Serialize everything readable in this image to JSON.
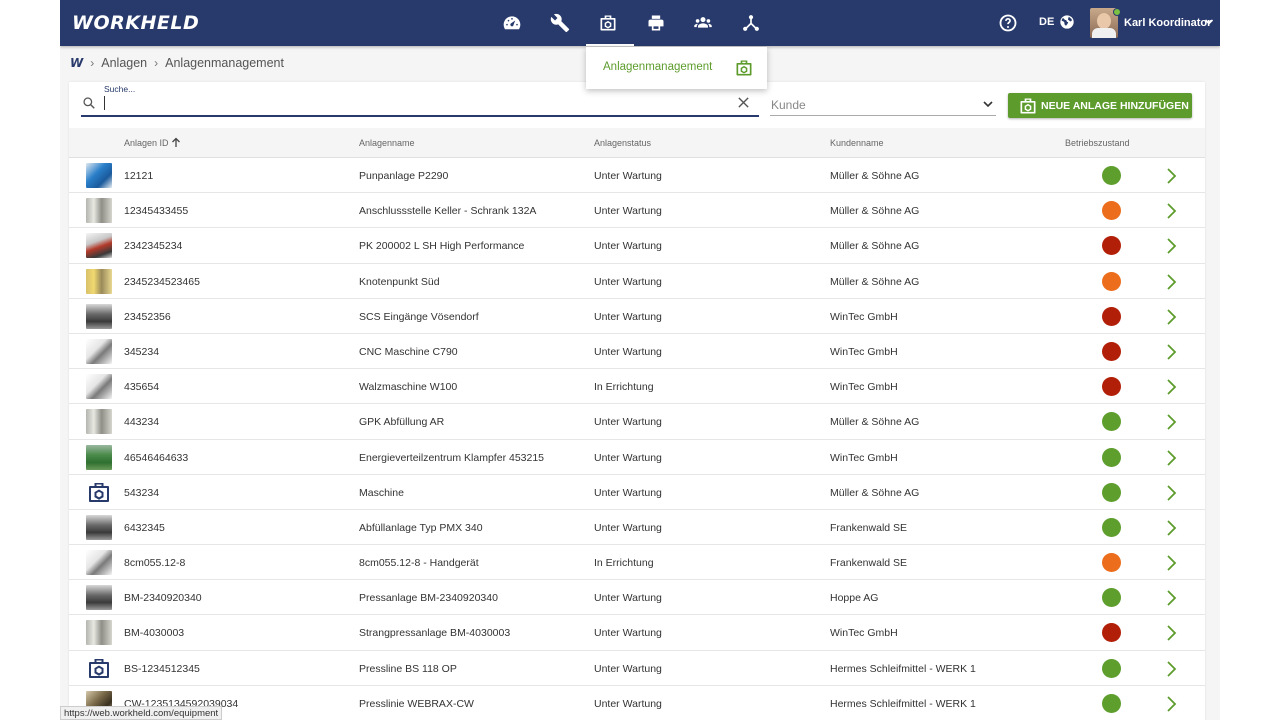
{
  "header": {
    "logo": "WORKHELD",
    "nav_icons": [
      "dashboard-icon",
      "wrench-icon",
      "equipment-icon",
      "printer-icon",
      "team-icon",
      "network-icon"
    ],
    "active_nav": "equipment-icon",
    "language": "DE",
    "user_name": "Karl Koordinator",
    "color": "#283a6c"
  },
  "breadcrumb": {
    "logo": "W",
    "items": [
      "Anlagen",
      "Anlagenmanagement"
    ]
  },
  "dropdown": {
    "label": "Anlagenmanagement"
  },
  "search": {
    "label": "Suche...",
    "value": ""
  },
  "filter": {
    "kunde_placeholder": "Kunde"
  },
  "add_button": {
    "label": "NEUE ANLAGE HINZUFÜGEN",
    "color": "#5d9c2c"
  },
  "table": {
    "headers": {
      "id": "Anlagen ID",
      "name": "Anlagenname",
      "status": "Anlagenstatus",
      "kunde": "Kundenname",
      "zustand": "Betriebszustand"
    },
    "state_colors": {
      "green": "#5e9e2d",
      "orange": "#ec6d1b",
      "red": "#b21f08"
    },
    "rows": [
      {
        "id": "12121",
        "name": "Punpanlage P2290",
        "status": "Unter Wartung",
        "kunde": "Müller & Söhne AG",
        "state": "green",
        "thumb": "photo-blue"
      },
      {
        "id": "12345433455",
        "name": "Anschlussstelle Keller - Schrank 132A",
        "status": "Unter Wartung",
        "kunde": "Müller & Söhne AG",
        "state": "orange",
        "thumb": "photo-grey"
      },
      {
        "id": "2342345234",
        "name": "PK 200002 L SH High Performance",
        "status": "Unter Wartung",
        "kunde": "Müller & Söhne AG",
        "state": "red",
        "thumb": "photo-red"
      },
      {
        "id": "2345234523465",
        "name": "Knotenpunkt Süd",
        "status": "Unter Wartung",
        "kunde": "Müller & Söhne AG",
        "state": "orange",
        "thumb": "photo-yellow"
      },
      {
        "id": "23452356",
        "name": "SCS Eingänge Vösendorf",
        "status": "Unter Wartung",
        "kunde": "WinTec GmbH",
        "state": "red",
        "thumb": "photo-dark"
      },
      {
        "id": "345234",
        "name": "CNC Maschine C790",
        "status": "Unter Wartung",
        "kunde": "WinTec GmbH",
        "state": "red",
        "thumb": "photo-white"
      },
      {
        "id": "435654",
        "name": "Walzmaschine W100",
        "status": "In Errichtung",
        "kunde": "WinTec GmbH",
        "state": "red",
        "thumb": "photo-white"
      },
      {
        "id": "443234",
        "name": "GPK Abfüllung AR",
        "status": "Unter Wartung",
        "kunde": "Müller & Söhne AG",
        "state": "green",
        "thumb": "photo-grey"
      },
      {
        "id": "46546464633",
        "name": "Energieverteilzentrum Klampfer 453215",
        "status": "Unter Wartung",
        "kunde": "WinTec GmbH",
        "state": "green",
        "thumb": "photo-green"
      },
      {
        "id": "543234",
        "name": "Maschine",
        "status": "Unter Wartung",
        "kunde": "Müller & Söhne AG",
        "state": "green",
        "thumb": "placeholder-icon"
      },
      {
        "id": "6432345",
        "name": "Abfüllanlage Typ PMX 340",
        "status": "Unter Wartung",
        "kunde": "Frankenwald SE",
        "state": "green",
        "thumb": "photo-dark"
      },
      {
        "id": "8cm055.12-8",
        "name": "8cm055.12-8 - Handgerät",
        "status": "In Errichtung",
        "kunde": "Frankenwald SE",
        "state": "orange",
        "thumb": "photo-white"
      },
      {
        "id": "BM-2340920340",
        "name": "Pressanlage BM-2340920340",
        "status": "Unter Wartung",
        "kunde": "Hoppe AG",
        "state": "green",
        "thumb": "photo-dark"
      },
      {
        "id": "BM-4030003",
        "name": "Strangpressanlage BM-4030003",
        "status": "Unter Wartung",
        "kunde": "WinTec GmbH",
        "state": "red",
        "thumb": "photo-grey"
      },
      {
        "id": "BS-1234512345",
        "name": "Pressline BS 118 OP",
        "status": "Unter Wartung",
        "kunde": "Hermes Schleifmittel - WERK 1",
        "state": "green",
        "thumb": "placeholder-icon"
      },
      {
        "id": "CW-1235134592039034",
        "name": "Presslinie WEBRAX-CW",
        "status": "Unter Wartung",
        "kunde": "Hermes Schleifmittel - WERK 1",
        "state": "green",
        "thumb": "photo-brown"
      }
    ]
  },
  "statusbar": {
    "url": "https://web.workheld.com/equipment"
  }
}
